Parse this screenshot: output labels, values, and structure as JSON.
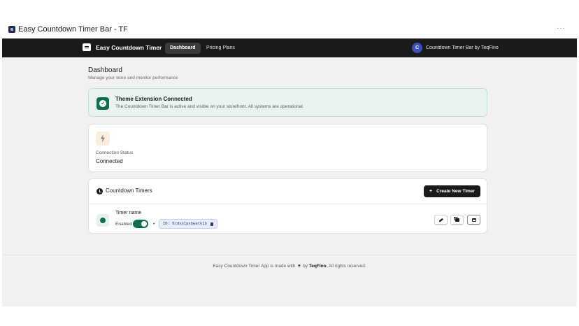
{
  "window": {
    "title": "Easy Countdown Timer Bar - TF",
    "more": "···"
  },
  "nav": {
    "brand": "Easy Countdown Timer",
    "tabs": [
      {
        "label": "Dashboard",
        "active": true
      },
      {
        "label": "Pricing Plans",
        "active": false
      }
    ],
    "account_initial": "C",
    "account_name": "Countdown Timer Bar by TeqFino"
  },
  "header": {
    "title": "Dashboard",
    "subtitle": "Manage your store and monitor performance"
  },
  "banner": {
    "title": "Theme Extension Connected",
    "description": "The Countdown Timer Bar is active and visible on your storefront. All systems are operational."
  },
  "status": {
    "label": "Connection Status",
    "value": "Connected"
  },
  "timers": {
    "title": "Countdown Timers",
    "create_label": "Create New Timer",
    "create_icon": "+",
    "items": [
      {
        "name": "Timer name",
        "status_label": "Enabled",
        "enabled": true,
        "id_text": "ID: 6cdxo1pxbwatk1b"
      }
    ]
  },
  "footer": {
    "prefix": "Easy Countdown Timer App is made with",
    "heart": "♥",
    "by": "by",
    "brand": "TeqFino",
    "suffix": ". All rights reserved."
  },
  "colors": {
    "accent": "#0e6e4e",
    "nav_bg": "#1a1a1a",
    "avatar": "#3d4fb8",
    "banner_bg": "#e9f4ef"
  }
}
